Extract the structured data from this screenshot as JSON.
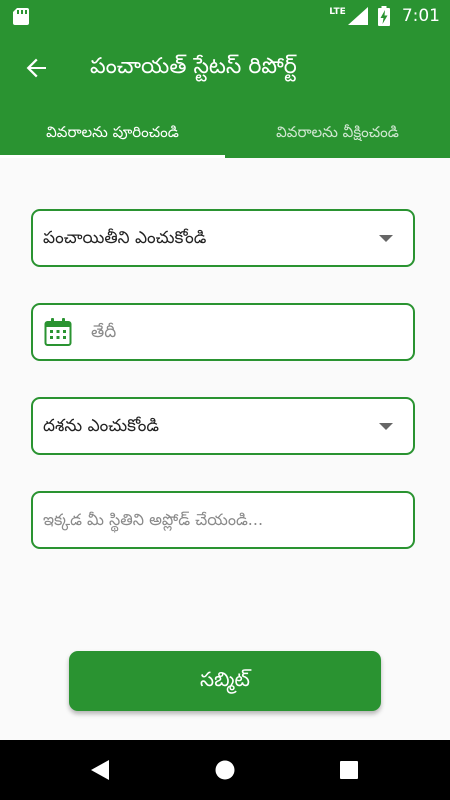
{
  "status_bar": {
    "network": "LTE",
    "time": "7:01"
  },
  "app_bar": {
    "title": "పంచాయత్ స్టేటస్ రిపోర్ట్",
    "tabs": [
      {
        "label": "వివరాలను పూరించండి",
        "selected": true
      },
      {
        "label": "వివరాలను వీక్షించండి",
        "selected": false
      }
    ]
  },
  "form": {
    "panchayat_dropdown": {
      "value": "పంచాయితీని ఎంచుకోండి"
    },
    "date_field": {
      "placeholder": "తేదీ",
      "value": ""
    },
    "stage_dropdown": {
      "value": "దశను ఎంచుకోండి"
    },
    "upload_field": {
      "placeholder": "ఇక్కడ మీ స్థితిని అప్లోడ్ చేయండి..."
    },
    "submit_label": "సబ్మిట్"
  },
  "colors": {
    "primary": "#2a9331",
    "background": "#fafafa",
    "nav_bar": "#000000"
  },
  "icons": {
    "sd_card": "sd-card-icon",
    "signal": "signal-icon",
    "battery": "battery-charging-icon",
    "back": "arrow-back-icon",
    "calendar": "calendar-icon",
    "dropdown": "dropdown-arrow-icon"
  }
}
